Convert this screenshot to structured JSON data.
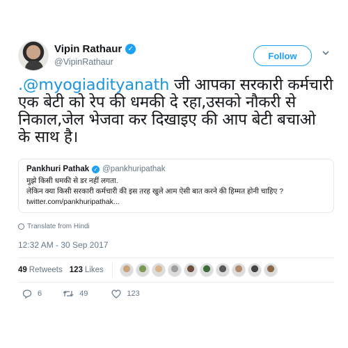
{
  "author": {
    "display_name": "Vipin Rathaur",
    "handle": "@VipinRathaur",
    "verified_icon": "✓"
  },
  "follow_label": "Follow",
  "tweet": {
    "mention": ".@myogiadityanath",
    "text_line1_rest": " जी आपका सरकारी कर्मचारी",
    "text_line2": "एक बेटी को रेप की धमकी दे रहा,उसको नौकरी से",
    "text_line3": "निकाल,जेल भेजवा कर दिखाइए की आप बेटी बचाओ",
    "text_line4": "के साथ है।"
  },
  "quote": {
    "name": "Pankhuri Pathak",
    "handle": "@pankhuripathak",
    "line1": "मुझे किसी धमकी से डर नहीं लगता.",
    "line2": "लेकिन क्या किसी सरकारी कर्मचारी की इस तरह खुले आम ऐसी बात करने की हिम्मत होनी चाहिए ?",
    "link": "twitter.com/pankhuripathak..."
  },
  "translate_label": "Translate from Hindi",
  "timestamp": "12:32 AM - 30 Sep 2017",
  "stats": {
    "retweets_count": "49",
    "retweets_label": "Retweets",
    "likes_count": "123",
    "likes_label": "Likes"
  },
  "liker_avatar_colors": [
    "#c8a27a",
    "#7a9a55",
    "#d9b58c",
    "#9e9e9e",
    "#6c4f3d",
    "#3d6b3a",
    "#5a5a5a",
    "#b08a6a",
    "#444444",
    "#8a6a4a"
  ],
  "actions": {
    "reply_count": "6",
    "retweet_count": "49",
    "like_count": "123"
  },
  "colors": {
    "accent": "#1da1f2",
    "link": "#1b95e0",
    "muted": "#657786"
  }
}
